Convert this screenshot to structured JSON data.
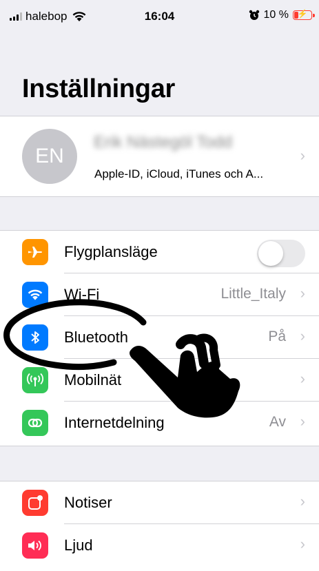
{
  "status_bar": {
    "carrier": "halebop",
    "time": "16:04",
    "battery": "10 %"
  },
  "title": "Inställningar",
  "profile": {
    "initials": "EN",
    "name": "Erik Nästegöl Todd",
    "subtitle": "Apple-ID, iCloud, iTunes och A..."
  },
  "group1": [
    {
      "label": "Flygplansläge",
      "icon": "airplane-icon",
      "color": "#ff9500",
      "toggle": false
    },
    {
      "label": "Wi-Fi",
      "value": "Little_Italy",
      "icon": "wifi-icon",
      "color": "#007aff"
    },
    {
      "label": "Bluetooth",
      "value": "På",
      "icon": "bluetooth-icon",
      "color": "#007aff"
    },
    {
      "label": "Mobilnät",
      "icon": "cellular-antenna-icon",
      "color": "#34c759"
    },
    {
      "label": "Internetdelning",
      "value": "Av",
      "icon": "hotspot-icon",
      "color": "#34c759"
    }
  ],
  "group2": [
    {
      "label": "Notiser",
      "icon": "notifications-icon",
      "color": "#ff3b30"
    },
    {
      "label": "Ljud",
      "icon": "speaker-icon",
      "color": "#ff2d55"
    }
  ]
}
